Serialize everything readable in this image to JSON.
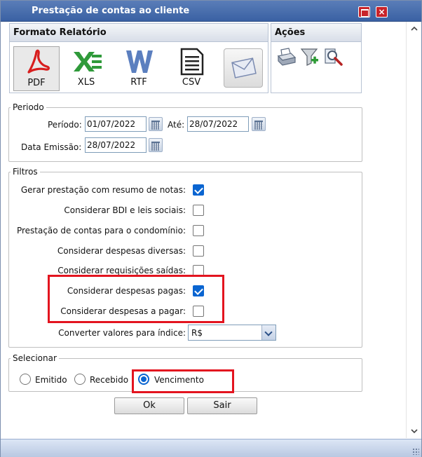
{
  "window": {
    "title": "Prestação de contas ao cliente",
    "close_glyph": "×"
  },
  "formato": {
    "header": "Formato Relatório",
    "buttons": [
      {
        "label": "PDF",
        "icon": "pdf-icon",
        "selected": true
      },
      {
        "label": "XLS",
        "icon": "xls-icon"
      },
      {
        "label": "RTF",
        "icon": "rtf-icon"
      },
      {
        "label": "CSV",
        "icon": "csv-icon"
      }
    ],
    "email_icon": "envelope-icon"
  },
  "acoes": {
    "header": "Ações",
    "icons": [
      "printer-icon",
      "filter-add-icon",
      "search-document-icon"
    ]
  },
  "periodo": {
    "legend": "Periodo",
    "periodo_label": "Período:",
    "periodo_de": "01/07/2022",
    "ate_label": "Até:",
    "periodo_ate": "28/07/2022",
    "emissao_label": "Data Emissão:",
    "emissao": "28/07/2022"
  },
  "filtros": {
    "legend": "Filtros",
    "items": [
      {
        "label": "Gerar prestação com resumo de notas:",
        "checked": true
      },
      {
        "label": "Considerar BDI e leis sociais:",
        "checked": false
      },
      {
        "label": "Prestação de contas para o condomínio:",
        "checked": false
      },
      {
        "label": "Considerar despesas diversas:",
        "checked": false
      },
      {
        "label": "Considerar requisições saídas:",
        "checked": false
      },
      {
        "label": "Considerar despesas pagas:",
        "checked": true
      },
      {
        "label": "Considerar despesas a pagar:",
        "checked": false
      }
    ],
    "indice_label": "Converter valores para índice:",
    "indice_value": "R$"
  },
  "selecionar": {
    "legend": "Selecionar",
    "options": [
      {
        "label": "Emitido",
        "selected": false
      },
      {
        "label": "Recebido",
        "selected": false
      },
      {
        "label": "Vencimento",
        "selected": true
      }
    ]
  },
  "buttons": {
    "ok": "Ok",
    "sair": "Sair"
  },
  "colors": {
    "titlebar": "#3a61a3",
    "highlight": "#e3141f",
    "check": "#0a65d1"
  }
}
